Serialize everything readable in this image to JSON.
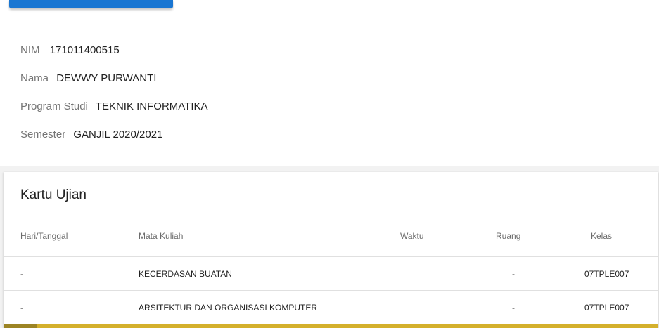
{
  "student": {
    "nim_label": "NIM",
    "nim_value": "171011400515",
    "nama_label": "Nama",
    "nama_value": "DEWWY PURWANTI",
    "prodi_label": "Program Studi",
    "prodi_value": "TEKNIK INFORMATIKA",
    "semester_label": "Semester",
    "semester_value": "GANJIL 2020/2021"
  },
  "exam_card": {
    "title": "Kartu Ujian",
    "columns": [
      "Hari/Tanggal",
      "Mata Kuliah",
      "Waktu",
      "Ruang",
      "Kelas"
    ],
    "rows": [
      {
        "hari": "-",
        "mata_kuliah": "KECERDASAN BUATAN",
        "waktu": "",
        "ruang": "-",
        "kelas": "07TPLE007"
      },
      {
        "hari": "-",
        "mata_kuliah": "ARSITEKTUR DAN ORGANISASI KOMPUTER",
        "waktu": "",
        "ruang": "-",
        "kelas": "07TPLE007"
      }
    ]
  },
  "colors": {
    "primary": "#1976d2",
    "accent_bar": "#d4b02c"
  }
}
